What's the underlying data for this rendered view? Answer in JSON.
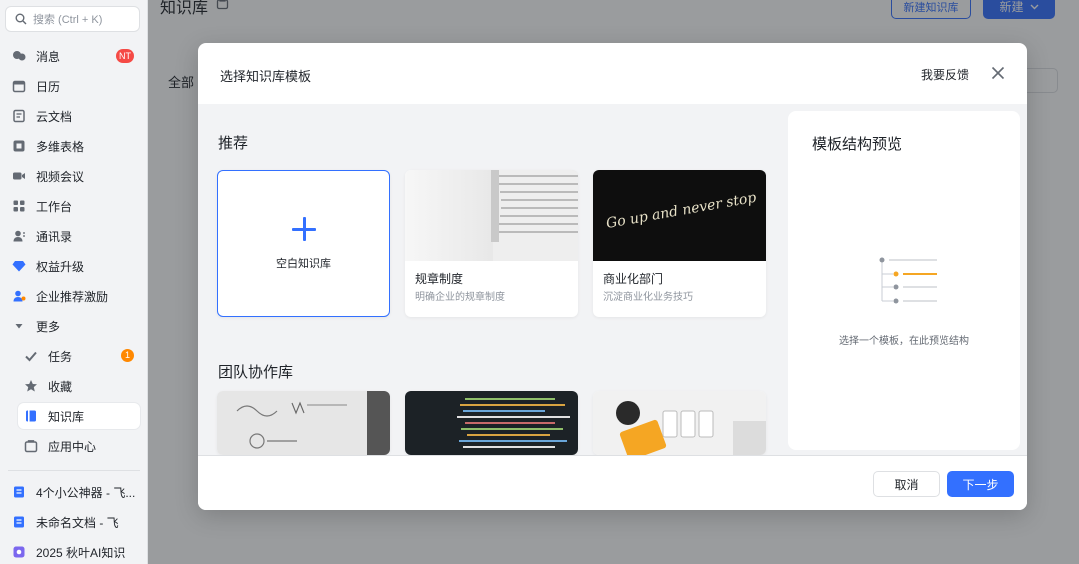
{
  "sidebar": {
    "search_placeholder": "搜索 (Ctrl + K)",
    "items": [
      {
        "label": "消息",
        "badge": "NT"
      },
      {
        "label": "日历"
      },
      {
        "label": "云文档"
      },
      {
        "label": "多维表格"
      },
      {
        "label": "视频会议"
      },
      {
        "label": "工作台"
      },
      {
        "label": "通讯录"
      },
      {
        "label": "权益升级"
      },
      {
        "label": "企业推荐激励"
      },
      {
        "label": "更多"
      }
    ],
    "sub_items": [
      {
        "label": "任务",
        "badge": "1"
      },
      {
        "label": "收藏"
      },
      {
        "label": "知识库"
      },
      {
        "label": "应用中心"
      }
    ],
    "recent": [
      {
        "label": "4个小公神器 - 飞..."
      },
      {
        "label": "未命名文档 - 飞"
      },
      {
        "label": "2025 秋叶AI知识"
      }
    ]
  },
  "background": {
    "title": "知识库",
    "new_kb_button": "新建知识库",
    "new_button": "新建",
    "all_label": "全部"
  },
  "modal": {
    "title": "选择知识库模板",
    "feedback": "我要反馈",
    "section_recommend": "推荐",
    "section_team": "团队协作库",
    "blank_card_label": "空白知识库",
    "cards": [
      {
        "name": "规章制度",
        "desc": "明确企业的规章制度"
      },
      {
        "name": "商业化部门",
        "desc": "沉淀商业化业务技巧",
        "cover_text": "Go up and never stop"
      }
    ],
    "preview": {
      "title": "模板结构预览",
      "hint": "选择一个模板，在此预览结构"
    },
    "cancel": "取消",
    "next": "下一步"
  },
  "colors": {
    "accent": "#3370ff",
    "badge_red": "#f54a45",
    "badge_orange": "#ff8800",
    "illus_orange": "#f5a623"
  }
}
